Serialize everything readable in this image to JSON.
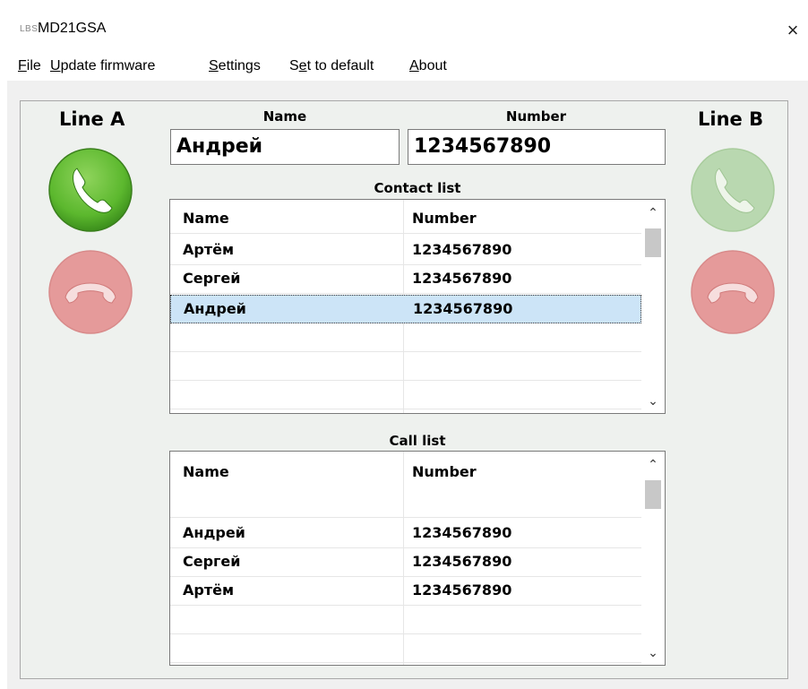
{
  "window": {
    "icon_text": "LBS",
    "title": "MD21GSA",
    "close_symbol": "×"
  },
  "menu": {
    "items": [
      {
        "ul": "F",
        "rest": "ile"
      },
      {
        "ul": "U",
        "rest": "pdate firmware"
      },
      {
        "ul": "S",
        "rest": "ettings"
      },
      {
        "pre": "S",
        "ul": "e",
        "rest": "t to default"
      },
      {
        "ul": "A",
        "rest": "bout"
      }
    ]
  },
  "line_a": {
    "label": "Line A",
    "answer_icon": "phone-answer-icon",
    "hangup_icon": "phone-hangup-icon"
  },
  "line_b": {
    "label": "Line B",
    "answer_icon": "phone-answer-icon",
    "hangup_icon": "phone-hangup-icon"
  },
  "fields": {
    "name_label": "Name",
    "number_label": "Number",
    "name_value": "Андрей",
    "number_value": "1234567890"
  },
  "contact_list": {
    "title": "Contact list",
    "columns": [
      "Name",
      "Number"
    ],
    "rows": [
      {
        "name": "Артём",
        "number": "1234567890"
      },
      {
        "name": "Сергей",
        "number": "1234567890"
      },
      {
        "name": "Андрей",
        "number": "1234567890"
      }
    ],
    "selected_index": 2
  },
  "call_list": {
    "title": "Call list",
    "columns": [
      "Name",
      "Number"
    ],
    "rows": [
      {
        "name": "",
        "number": ""
      },
      {
        "name": "Андрей",
        "number": "1234567890"
      },
      {
        "name": "Сергей",
        "number": "1234567890"
      },
      {
        "name": "Артём",
        "number": "1234567890"
      }
    ]
  },
  "colors": {
    "answer_active": "#5cb82e",
    "answer_inactive": "#b9d8b0",
    "hangup_inactive": "#e59a9a",
    "selection": "#cce4f7"
  }
}
